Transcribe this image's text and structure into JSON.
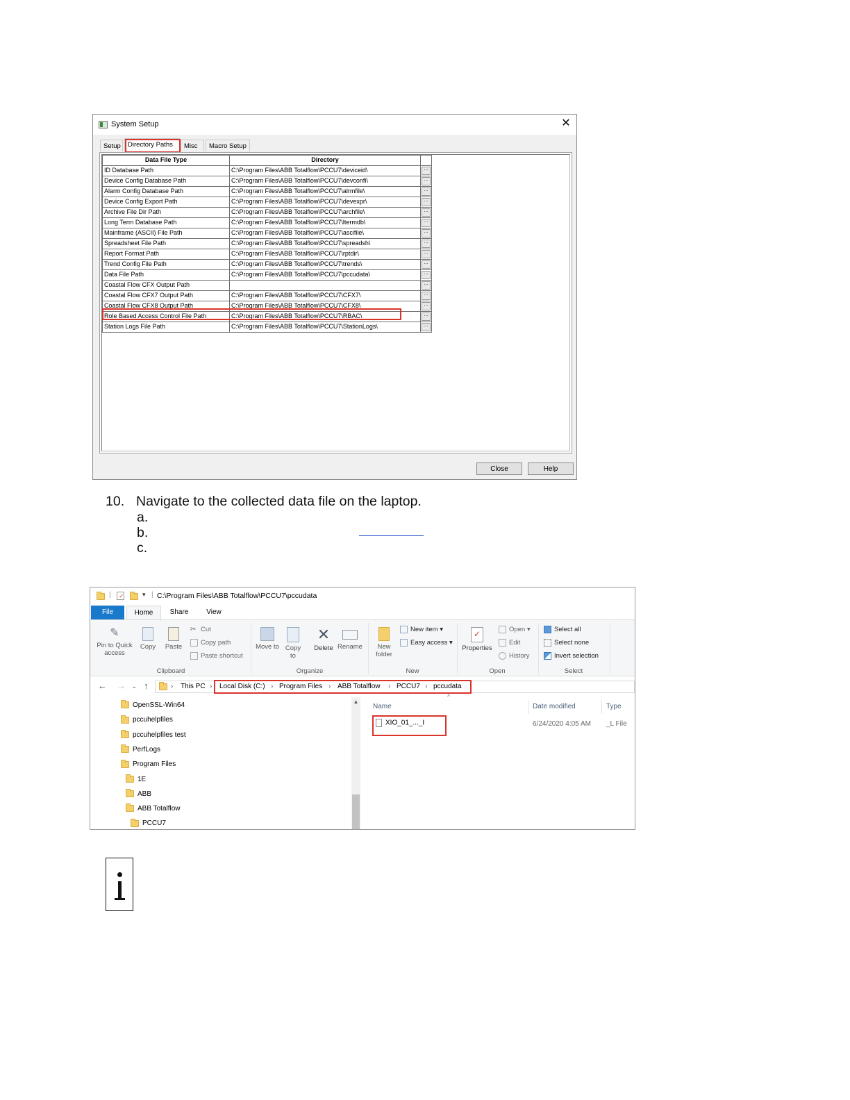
{
  "system_setup": {
    "title": "System Setup",
    "close_glyph": "✕",
    "tabs": [
      "Setup",
      "Directory Paths",
      "Misc",
      "Macro Setup"
    ],
    "active_tab": "Directory Paths",
    "columns": [
      "Data File Type",
      "Directory"
    ],
    "browse_label": "...",
    "rows": [
      {
        "type": "ID Database Path",
        "dir": "C:\\Program Files\\ABB Totalflow\\PCCU7\\deviceid\\"
      },
      {
        "type": "Device Config Database Path",
        "dir": "C:\\Program Files\\ABB Totalflow\\PCCU7\\devconfi\\"
      },
      {
        "type": "Alarm Config Database Path",
        "dir": "C:\\Program Files\\ABB Totalflow\\PCCU7\\alrmfile\\"
      },
      {
        "type": "Device Config Export Path",
        "dir": "C:\\Program Files\\ABB Totalflow\\PCCU7\\devexpr\\"
      },
      {
        "type": "Archive File Dir Path",
        "dir": "C:\\Program Files\\ABB Totalflow\\PCCU7\\archfile\\"
      },
      {
        "type": "Long Term Database Path",
        "dir": "C:\\Program Files\\ABB Totalflow\\PCCU7\\ltermdb\\"
      },
      {
        "type": "Mainframe (ASCII) File Path",
        "dir": "C:\\Program Files\\ABB Totalflow\\PCCU7\\ascifile\\"
      },
      {
        "type": "Spreadsheet File Path",
        "dir": "C:\\Program Files\\ABB Totalflow\\PCCU7\\spreadsh\\"
      },
      {
        "type": "Report Format Path",
        "dir": "C:\\Program Files\\ABB Totalflow\\PCCU7\\rptdir\\"
      },
      {
        "type": "Trend Config File Path",
        "dir": "C:\\Program Files\\ABB Totalflow\\PCCU7\\trends\\"
      },
      {
        "type": "Data File Path",
        "dir": "C:\\Program Files\\ABB Totalflow\\PCCU7\\pccudata\\"
      },
      {
        "type": "Coastal Flow CFX Output Path",
        "dir": ""
      },
      {
        "type": "Coastal Flow CFX7 Output Path",
        "dir": "C:\\Program Files\\ABB Totalflow\\PCCU7\\CFX7\\"
      },
      {
        "type": "Coastal Flow CFX8 Output Path",
        "dir": "C:\\Program Files\\ABB Totalflow\\PCCU7\\CFX8\\"
      },
      {
        "type": "Role Based Access Control File Path",
        "dir": "C:\\Program Files\\ABB Totalflow\\PCCU7\\RBAC\\"
      },
      {
        "type": "Station Logs File Path",
        "dir": "C:\\Program Files\\ABB Totalflow\\PCCU7\\StationLogs\\"
      }
    ],
    "highlighted_row": "Data File Path",
    "buttons": {
      "close": "Close",
      "help": "Help"
    }
  },
  "instructions": {
    "step_number": "10.",
    "step_text": "Navigate to the collected data file on the laptop.",
    "sub_letters": [
      "a.",
      "b.",
      "c."
    ]
  },
  "explorer": {
    "qat_path": "C:\\Program Files\\ABB Totalflow\\PCCU7\\pccudata",
    "ribbon_tabs": [
      "File",
      "Home",
      "Share",
      "View"
    ],
    "ribbon": {
      "pin": "Pin to Quick access",
      "copy": "Copy",
      "paste": "Paste",
      "cut": "Cut",
      "copy_path": "Copy path",
      "paste_shortcut": "Paste shortcut",
      "move_to": "Move to",
      "copy_to": "Copy to",
      "delete": "Delete",
      "rename": "Rename",
      "new_folder": "New folder",
      "new_item": "New item",
      "easy_access": "Easy access",
      "properties": "Properties",
      "open": "Open",
      "edit": "Edit",
      "history": "History",
      "select_all": "Select all",
      "select_none": "Select none",
      "invert_selection": "Invert selection",
      "groups": [
        "Clipboard",
        "Organize",
        "New",
        "Open",
        "Select"
      ]
    },
    "breadcrumb": [
      "This PC",
      "Local Disk (C:)",
      "Program Files",
      "ABB Totalflow",
      "PCCU7",
      "pccudata"
    ],
    "tree": [
      {
        "name": "OpenSSL-Win64",
        "level": 0
      },
      {
        "name": "pccuhelpfiles",
        "level": 0
      },
      {
        "name": "pccuhelpfiles test",
        "level": 0
      },
      {
        "name": "PerfLogs",
        "level": 0
      },
      {
        "name": "Program Files",
        "level": 0
      },
      {
        "name": "1E",
        "level": 1
      },
      {
        "name": "ABB",
        "level": 1
      },
      {
        "name": "ABB Totalflow",
        "level": 1
      },
      {
        "name": "PCCU7",
        "level": 2
      }
    ],
    "columns": [
      "Name",
      "Date modified",
      "Type"
    ],
    "files": [
      {
        "name": "XIO_01_..._I",
        "date": "6/24/2020 4:05 AM",
        "type": "_L File"
      }
    ]
  }
}
